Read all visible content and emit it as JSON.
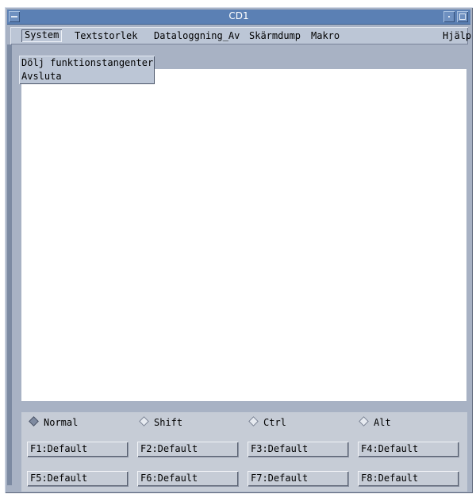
{
  "window": {
    "title": "CD1"
  },
  "menubar": {
    "items": [
      "System",
      "Textstorlek",
      "Dataloggning_Av",
      "Skärmdump",
      "Makro"
    ],
    "help": "Hjälp"
  },
  "system_menu": {
    "items": [
      "Dölj funktionstangenter",
      "Avsluta"
    ]
  },
  "modifiers": {
    "selected": "Normal",
    "options": [
      "Normal",
      "Shift",
      "Ctrl",
      "Alt"
    ]
  },
  "function_keys": [
    "F1:Default",
    "F2:Default",
    "F3:Default",
    "F4:Default",
    "F5:Default",
    "F6:Default",
    "F7:Default",
    "F8:Default"
  ]
}
